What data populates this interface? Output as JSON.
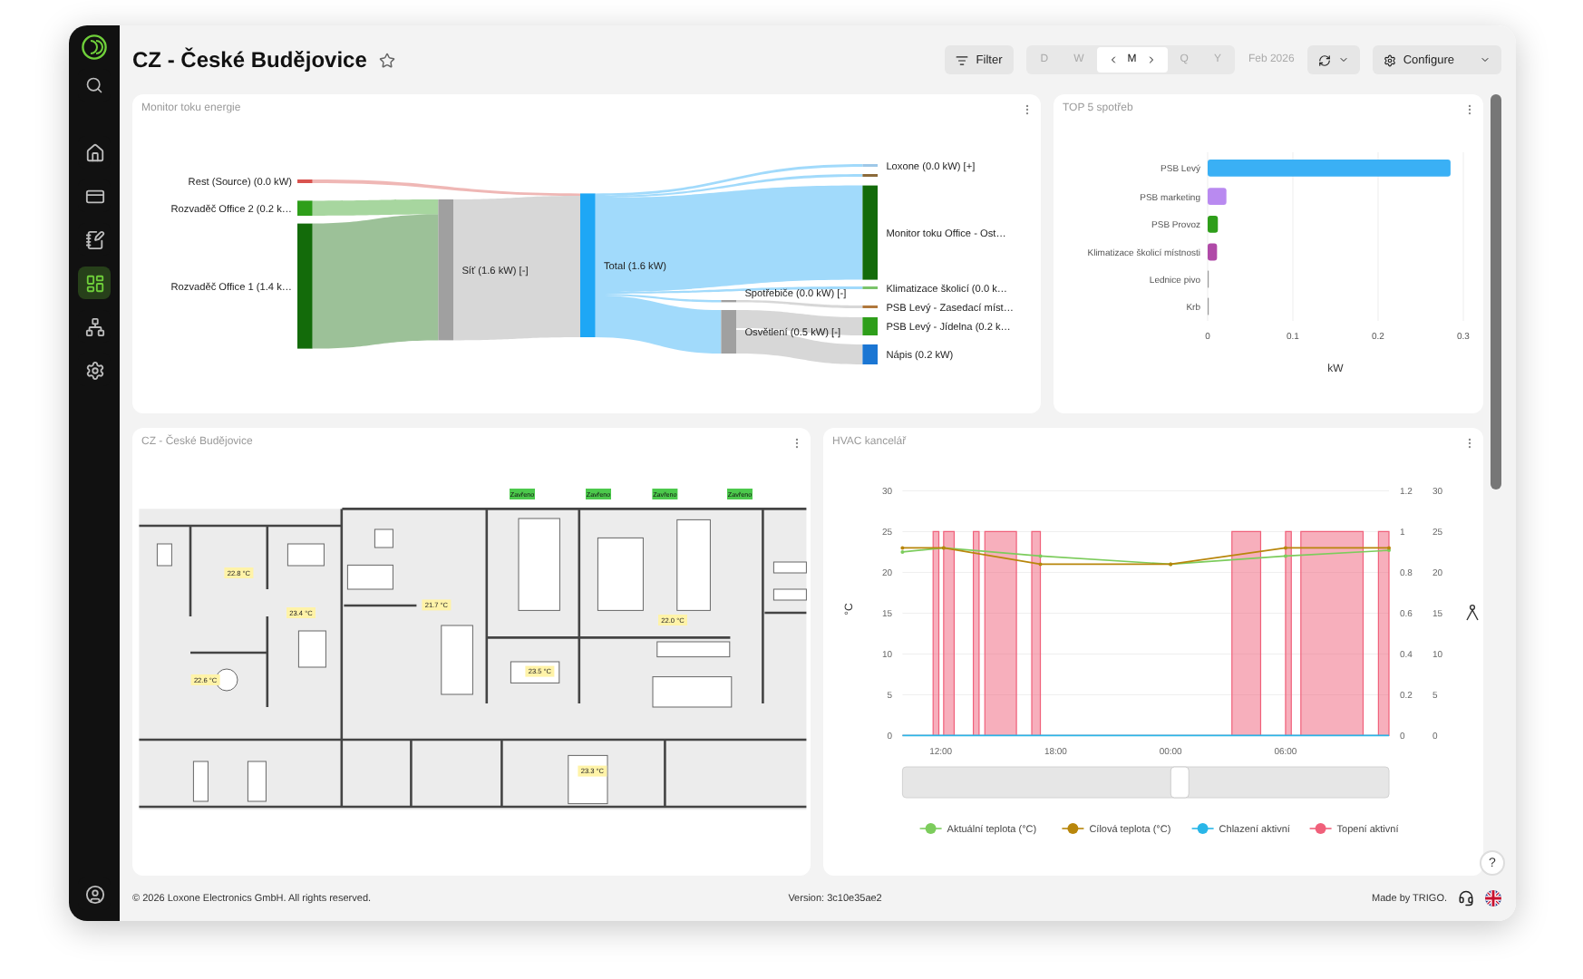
{
  "sidebar": {
    "items": [
      {
        "kind": "search",
        "selected": false
      },
      {
        "kind": "home",
        "selected": false
      },
      {
        "kind": "storage",
        "selected": false
      },
      {
        "kind": "notes",
        "selected": false
      },
      {
        "kind": "dashboard",
        "selected": true
      },
      {
        "kind": "network",
        "selected": false
      },
      {
        "kind": "settings",
        "selected": false
      },
      {
        "kind": "account",
        "selected": false
      }
    ]
  },
  "header": {
    "title": "CZ - České Budějovice",
    "filter": "Filter",
    "periods": [
      {
        "label": "D",
        "selected": false
      },
      {
        "label": "W",
        "selected": false
      },
      {
        "label": "M",
        "selected": true
      },
      {
        "label": "Q",
        "selected": false
      },
      {
        "label": "Y",
        "selected": false
      }
    ],
    "period_label": "Feb 2026",
    "configure": "Configure"
  },
  "energy_flow": {
    "title": "Monitor toku energie",
    "nodes": [
      {
        "label": "Rest (Source) (0.0 kW)",
        "color": "#d9534f"
      },
      {
        "label": "Rozvaděč Office 2 (0.2 k…",
        "color": "#2e9e1a"
      },
      {
        "label": "Rozvaděč Office 1 (1.4 k…",
        "color": "#136b0a"
      },
      {
        "label": "Síť (1.6 kW) [-]",
        "color": "#a0a0a0"
      },
      {
        "label": "Total (1.6 kW)",
        "color": "#1ea7f5"
      },
      {
        "label": "Loxone (0.0 kW) [+]",
        "color": "#9ec8e8"
      },
      {
        "color": "#8b6a3a"
      },
      {
        "label": "Monitor toku Office - Ost…",
        "color": "#136b0a"
      },
      {
        "label": "Klimatizace školicí (0.0 k…",
        "color": "#7ac36a"
      },
      {
        "label": "Spotřebiče (0.0 kW) [-]",
        "color": "#a0a0a0"
      },
      {
        "label": "PSB Levý - Zasedací míst…",
        "color": "#b0783c"
      },
      {
        "label": "Osvětlení (0.5 kW) [-]",
        "color": "#a0a0a0"
      },
      {
        "label": "PSB Levý - Jídelna (0.2 k…",
        "color": "#2e9e1a"
      },
      {
        "label": "Nápis (0.2 kW)",
        "color": "#1b76d3"
      }
    ]
  },
  "top_consumers": {
    "title": "TOP 5 spotřeb",
    "chart_data": {
      "type": "bar",
      "orientation": "horizontal",
      "xlabel": "kW",
      "categories": [
        "PSB Levý",
        "PSB marketing",
        "PSB Provoz",
        "Klimatizace školicí místnosti",
        "Lednice pivo",
        "Krb"
      ],
      "values": [
        0.285,
        0.022,
        0.012,
        0.011,
        0,
        0
      ],
      "colors": [
        "#3ab0f5",
        "#b98af0",
        "#2e9e1a",
        "#b04aa8",
        "#999999",
        "#999999"
      ],
      "xlim": [
        0,
        0.3
      ],
      "xticks": [
        0,
        0.1,
        0.2,
        0.3
      ]
    }
  },
  "floor_plan": {
    "title": "CZ - České Budějovice",
    "door_tags": [
      "Zavřeno",
      "Zavřeno",
      "Zavřeno",
      "Zavřeno"
    ],
    "temperatures": [
      "22.8 °C",
      "23.4 °C",
      "21.7 °C",
      "22.0 °C",
      "23.5 °C",
      "22.6 °C",
      "23.3 °C"
    ]
  },
  "hvac": {
    "title": "HVAC kancelář",
    "chart_data": {
      "type": "line",
      "ylabel": "°C",
      "grid": true,
      "legend": "bottom",
      "x": [
        "2026-02-01T10:00",
        "2026-02-01T11:36",
        "2026-02-01T11:36",
        "2026-02-01T11:54",
        "2026-02-01T11:54",
        "2026-02-01T12:09",
        "2026-02-01T12:09",
        "2026-02-01T12:42",
        "2026-02-01T12:42",
        "2026-02-01T13:42",
        "2026-02-01T13:42",
        "2026-02-01T14:00",
        "2026-02-01T14:00",
        "2026-02-01T14:18",
        "2026-02-01T14:18",
        "2026-02-01T15:57",
        "2026-02-01T15:57",
        "2026-02-01T16:45",
        "2026-02-01T16:45",
        "2026-02-01T17:12",
        "2026-02-01T17:12",
        "2026-02-02T00:00",
        "2026-02-02T03:12",
        "2026-02-02T03:12",
        "2026-02-02T04:42",
        "2026-02-02T04:42",
        "2026-02-02T06:00",
        "2026-02-02T06:00",
        "2026-02-02T06:18",
        "2026-02-02T06:18",
        "2026-02-02T06:48",
        "2026-02-02T06:48",
        "2026-02-02T10:03",
        "2026-02-02T10:03",
        "2026-02-02T10:51",
        "2026-02-02T10:51",
        "2026-02-02T11:24"
      ],
      "xlim": [
        "2026-02-01T10:00",
        "2026-02-02T11:24"
      ],
      "xticks": [
        {
          "value": "2026-02-01T12:00",
          "label": "12:00"
        },
        {
          "value": "2026-02-01T18:00",
          "label": "18:00"
        },
        {
          "value": "2026-02-02T00:00",
          "label": "00:00"
        },
        {
          "value": "2026-02-02T06:00",
          "label": "06:00"
        }
      ],
      "ylim": [
        0,
        30
      ],
      "yticks": [
        0,
        5,
        10,
        15,
        20,
        25,
        30
      ],
      "y2lim": [
        0,
        1.2
      ],
      "y2ticks": [
        {
          "value": 0,
          "label": "0"
        },
        {
          "value": 0.2,
          "label": "0.2"
        },
        {
          "value": 0.4,
          "label": "0.4"
        },
        {
          "value": 0.6,
          "label": "0.6"
        },
        {
          "value": 0.8,
          "label": "0.8"
        },
        {
          "value": 1,
          "label": "1"
        },
        {
          "value": 1.2,
          "label": "1.2"
        }
      ],
      "y3lim": [
        0,
        30
      ],
      "y3ticks": [
        0,
        5,
        10,
        15,
        20,
        25,
        30
      ],
      "series": [
        {
          "name": "Aktuální teplota (°C)",
          "color": "#7ccc5c",
          "values": [
            22.5,
            null,
            null,
            null,
            null,
            23,
            null,
            null,
            null,
            null,
            null,
            null,
            null,
            null,
            null,
            null,
            null,
            null,
            null,
            22,
            null,
            21,
            null,
            null,
            null,
            null,
            22,
            null,
            null,
            null,
            null,
            null,
            null,
            null,
            null,
            null,
            22.7
          ]
        },
        {
          "name": "Cílová teplota (°C)",
          "color": "#b8860b",
          "values": [
            23,
            null,
            null,
            null,
            null,
            23,
            null,
            null,
            null,
            null,
            null,
            null,
            null,
            null,
            null,
            null,
            null,
            null,
            null,
            21,
            null,
            21,
            null,
            null,
            null,
            null,
            23,
            null,
            null,
            null,
            null,
            null,
            null,
            null,
            null,
            null,
            23
          ]
        },
        {
          "name": "Chlazení aktivní",
          "color": "#29b6e8",
          "values": [
            0,
            0,
            0,
            0,
            0,
            0,
            0,
            0,
            0,
            0,
            0,
            0,
            0,
            0,
            0,
            0,
            0,
            0,
            0,
            0,
            0,
            0,
            0,
            0,
            0,
            0,
            0,
            0,
            0,
            0,
            0,
            0,
            0,
            0,
            0,
            0,
            0
          ]
        },
        {
          "name": "Topení aktivní",
          "color": "#f0607a",
          "type": "area",
          "values": [
            0,
            0,
            25,
            25,
            0,
            0,
            25,
            25,
            0,
            0,
            25,
            25,
            0,
            0,
            25,
            25,
            0,
            0,
            25,
            25,
            0,
            0,
            0,
            25,
            25,
            0,
            0,
            25,
            25,
            0,
            0,
            25,
            25,
            0,
            0,
            25,
            25
          ]
        }
      ]
    },
    "range": {
      "level": 0.57
    }
  },
  "help": "?",
  "footer": {
    "copyright": "© 2026 Loxone Electronics GmbH. All rights reserved.",
    "version": "Version: 3c10e35ae2",
    "made_by": "Made by TRIGO."
  }
}
